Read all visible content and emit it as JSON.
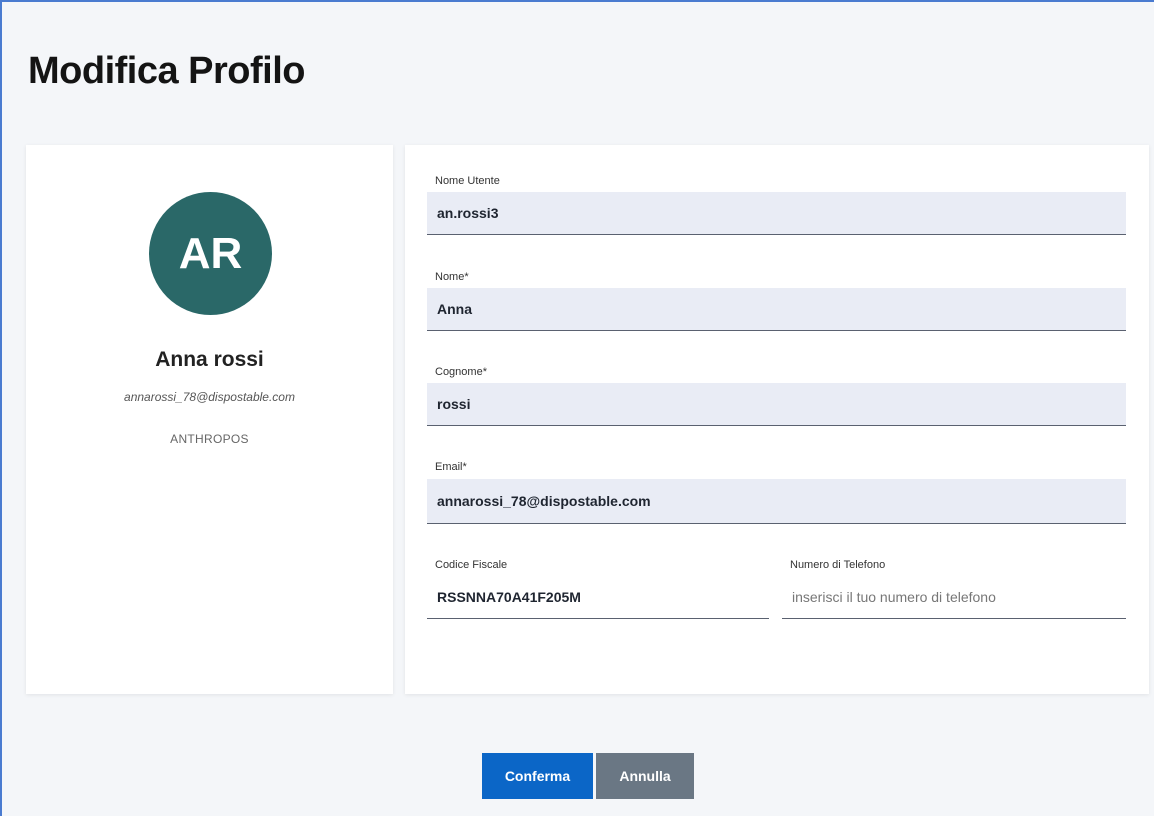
{
  "page": {
    "title": "Modifica Profilo"
  },
  "profile": {
    "initials": "AR",
    "name": "Anna rossi",
    "email": "annarossi_78@dispostable.com",
    "organization": "ANTHROPOS"
  },
  "form": {
    "username": {
      "label": "Nome Utente",
      "value": "an.rossi3"
    },
    "first_name": {
      "label": "Nome*",
      "value": "Anna"
    },
    "last_name": {
      "label": "Cognome*",
      "value": "rossi"
    },
    "email": {
      "label": "Email*",
      "value": "annarossi_78@dispostable.com"
    },
    "tax_code": {
      "label": "Codice Fiscale",
      "value": "RSSNNA70A41F205M"
    },
    "phone": {
      "label": "Numero di Telefono",
      "value": "",
      "placeholder": "inserisci il tuo numero di telefono"
    }
  },
  "actions": {
    "confirm_label": "Conferma",
    "cancel_label": "Annulla"
  },
  "colors": {
    "avatar_bg": "#2a6868",
    "primary": "#0b66c7",
    "secondary": "#6a7784",
    "input_bg": "#e9ecf5"
  }
}
